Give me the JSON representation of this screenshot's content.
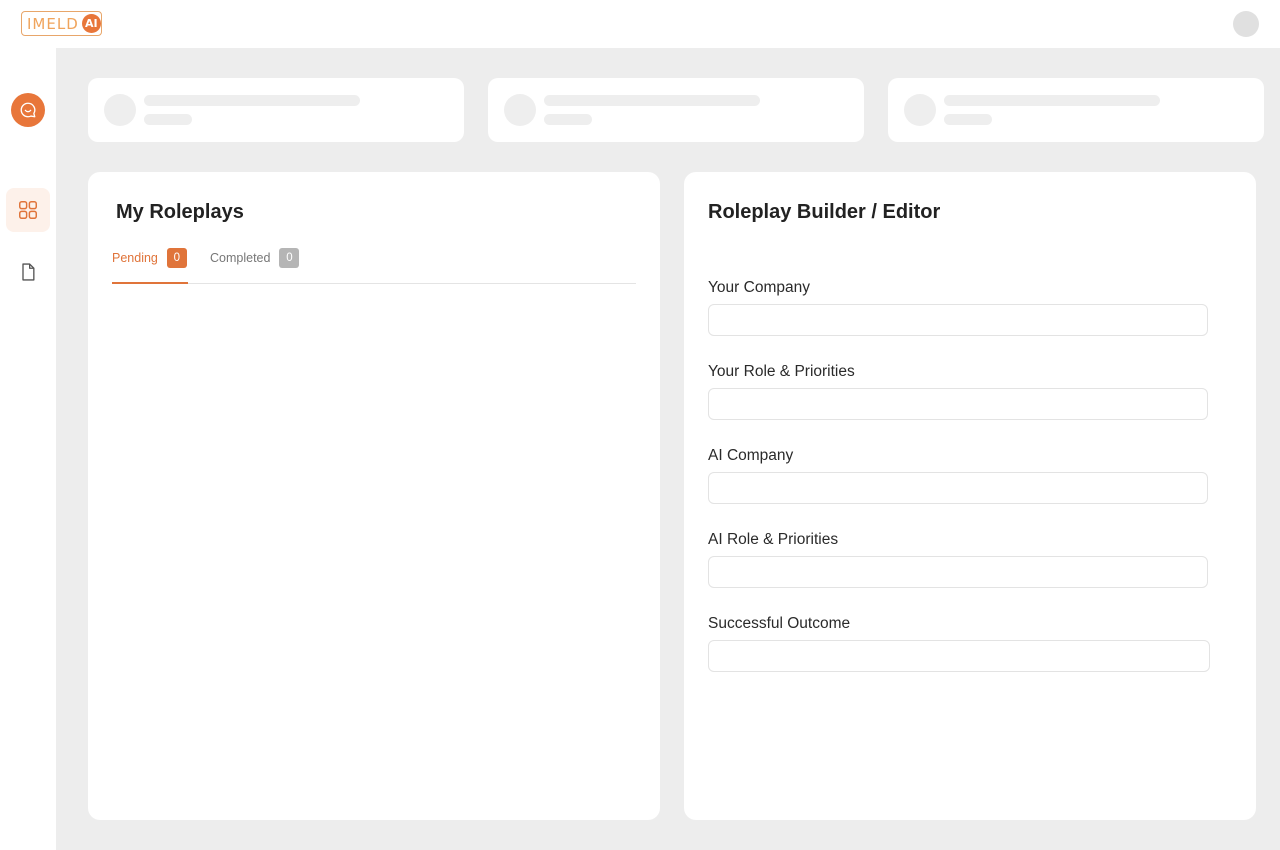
{
  "header": {
    "logo_text": "IMELD",
    "logo_badge": "AI"
  },
  "sidebar": {
    "items": [
      {
        "name": "chat",
        "icon": "chat-icon"
      },
      {
        "name": "dashboard",
        "icon": "grid-icon",
        "active": true
      },
      {
        "name": "documents",
        "icon": "document-icon"
      }
    ]
  },
  "colors": {
    "accent": "#e0743a",
    "background": "#ededed",
    "panel": "#ffffff"
  },
  "my_roleplays": {
    "title": "My Roleplays",
    "tabs": [
      {
        "label": "Pending",
        "count": "0",
        "active": true
      },
      {
        "label": "Completed",
        "count": "0",
        "active": false
      }
    ]
  },
  "builder": {
    "title": "Roleplay Builder / Editor",
    "fields": [
      {
        "label": "Your Company",
        "value": ""
      },
      {
        "label": "Your Role & Priorities",
        "value": ""
      },
      {
        "label": "AI Company",
        "value": ""
      },
      {
        "label": "AI Role & Priorities",
        "value": ""
      },
      {
        "label": "Successful Outcome",
        "value": ""
      }
    ]
  }
}
